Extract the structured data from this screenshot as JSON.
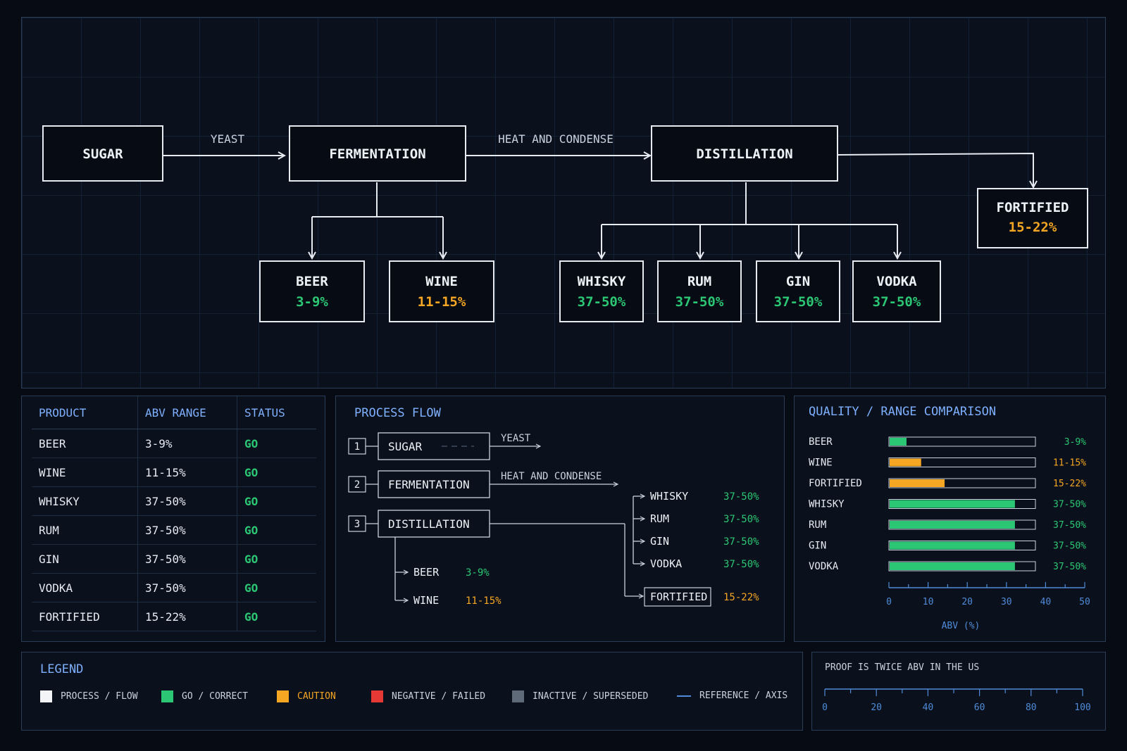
{
  "diagram": {
    "nodes": {
      "sugar": "SUGAR",
      "fermentation": "FERMENTATION",
      "distillation": "DISTILLATION",
      "fortified": {
        "name": "FORTIFIED",
        "abv": "15-22%"
      },
      "beer": {
        "name": "BEER",
        "abv": "3-9%"
      },
      "wine": {
        "name": "WINE",
        "abv": "11-15%"
      },
      "whisky": {
        "name": "WHISKY",
        "abv": "37-50%"
      },
      "rum": {
        "name": "RUM",
        "abv": "37-50%"
      },
      "gin": {
        "name": "GIN",
        "abv": "37-50%"
      },
      "vodka": {
        "name": "VODKA",
        "abv": "37-50%"
      }
    },
    "edges": {
      "yeast": "YEAST",
      "heat": "HEAT AND CONDENSE"
    }
  },
  "table": {
    "headers": [
      "PRODUCT",
      "ABV RANGE",
      "STATUS"
    ],
    "rows": [
      [
        "BEER",
        "3-9%",
        "GO"
      ],
      [
        "WINE",
        "11-15%",
        "GO"
      ],
      [
        "WHISKY",
        "37-50%",
        "GO"
      ],
      [
        "RUM",
        "37-50%",
        "GO"
      ],
      [
        "GIN",
        "37-50%",
        "GO"
      ],
      [
        "VODKA",
        "37-50%",
        "GO"
      ],
      [
        "FORTIFIED",
        "15-22%",
        "GO"
      ]
    ]
  },
  "process_flow": {
    "title": "PROCESS FLOW",
    "steps": [
      {
        "num": "1",
        "name": "SUGAR",
        "edge": "YEAST"
      },
      {
        "num": "2",
        "name": "FERMENTATION",
        "edge": "HEAT AND CONDENSE"
      },
      {
        "num": "3",
        "name": "DISTILLATION"
      }
    ],
    "ferment_outputs": [
      {
        "name": "BEER",
        "abv": "3-9%"
      },
      {
        "name": "WINE",
        "abv": "11-15%"
      }
    ],
    "distill_outputs": [
      {
        "name": "WHISKY",
        "abv": "37-50%"
      },
      {
        "name": "RUM",
        "abv": "37-50%"
      },
      {
        "name": "GIN",
        "abv": "37-50%"
      },
      {
        "name": "VODKA",
        "abv": "37-50%"
      }
    ],
    "fortified": {
      "name": "FORTIFIED",
      "abv": "15-22%"
    }
  },
  "quality": {
    "title": "QUALITY / RANGE COMPARISON",
    "axis_label": "ABV (%)",
    "axis_ticks": [
      "0",
      "10",
      "20",
      "30",
      "40",
      "50"
    ],
    "axis_max": 50
  },
  "chart_data": {
    "type": "bar",
    "categories": [
      "BEER",
      "WINE",
      "FORTIFIED",
      "WHISKY",
      "RUM",
      "GIN",
      "VODKA"
    ],
    "values": [
      6,
      11,
      19,
      43,
      43,
      43,
      43
    ],
    "range_labels": [
      "3-9%",
      "11-15%",
      "15-22%",
      "37-50%",
      "37-50%",
      "37-50%",
      "37-50%"
    ],
    "colors": [
      "#2cc774",
      "#f5a623",
      "#f5a623",
      "#2cc774",
      "#2cc774",
      "#2cc774",
      "#2cc774"
    ],
    "xlabel": "ABV (%)",
    "xlim": [
      0,
      50
    ],
    "orientation": "horizontal"
  },
  "legend": {
    "title": "LEGEND",
    "items": [
      {
        "label": "PROCESS / FLOW",
        "color": "#f2f4f7"
      },
      {
        "label": "GO / CORRECT",
        "color": "#2cc774"
      },
      {
        "label": "CAUTION",
        "color": "#f5a623"
      },
      {
        "label": "NEGATIVE / FAILED",
        "color": "#e53935"
      },
      {
        "label": "INACTIVE / SUPERSEDED",
        "color": "#5f6b78"
      },
      {
        "label": "REFERENCE / AXIS",
        "color": "#4f8bd8"
      }
    ]
  },
  "proof": {
    "title": "PROOF IS TWICE ABV IN THE US",
    "ticks": [
      "0",
      "20",
      "40",
      "60",
      "80",
      "100"
    ]
  },
  "colors": {
    "go": "#2cc774",
    "caution": "#f5a623",
    "reference": "#4f8bd8",
    "header": "#7fb0ff"
  }
}
